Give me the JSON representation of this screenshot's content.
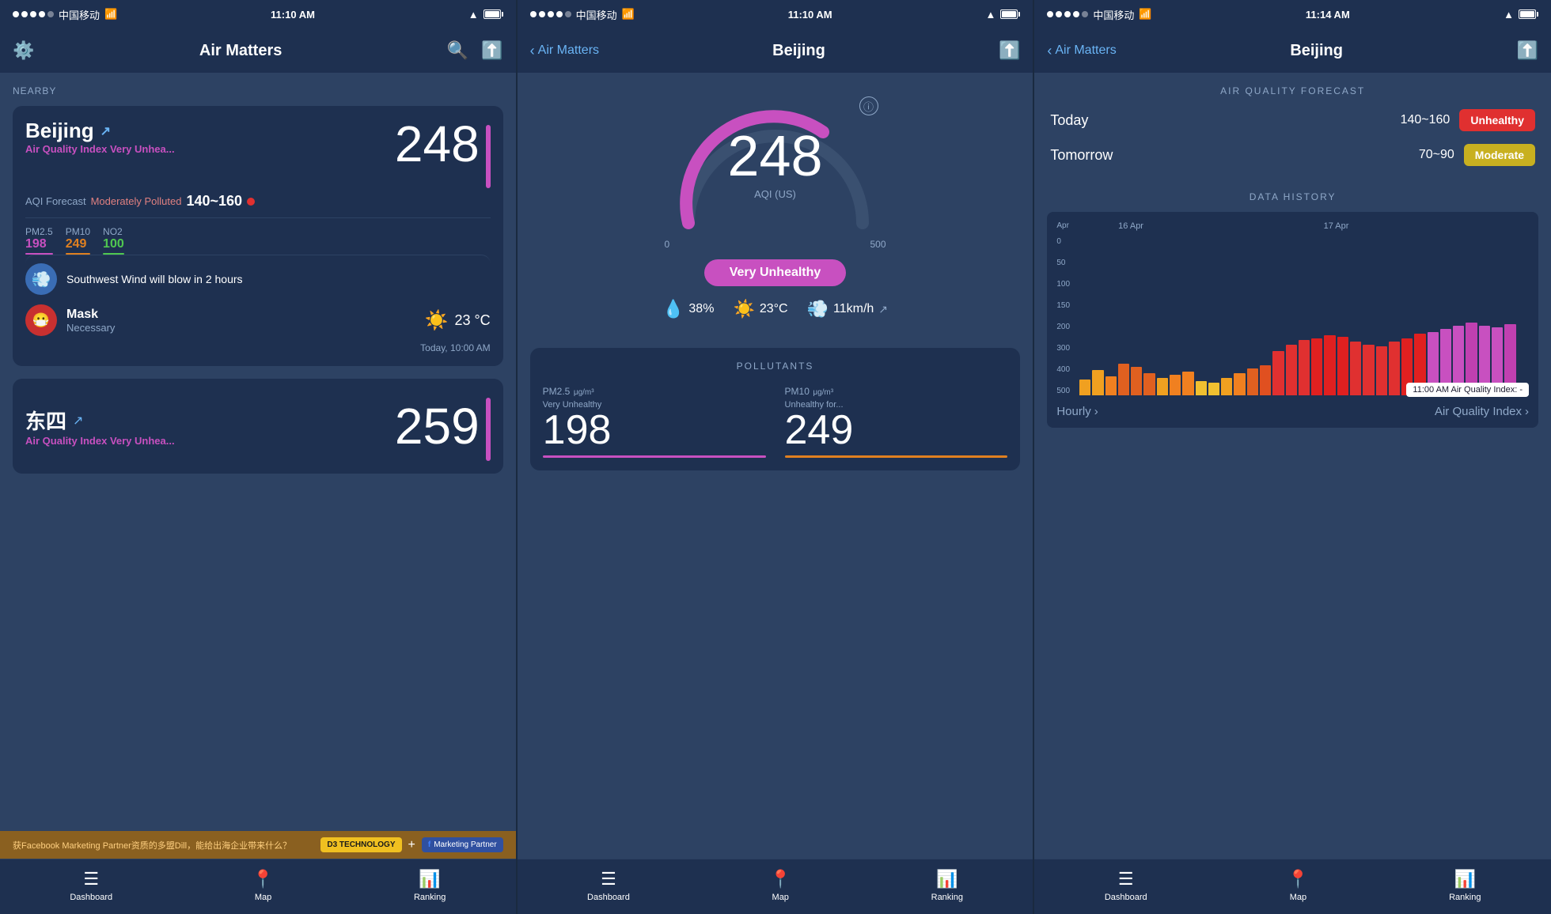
{
  "screen1": {
    "status": {
      "carrier": "中国移动",
      "time": "11:10 AM",
      "signal": true
    },
    "nav": {
      "title": "Air Matters"
    },
    "nearby_label": "NEARBY",
    "city1": {
      "name": "Beijing",
      "aqi": "248",
      "aqi_label": "Air Quality Index",
      "aqi_status": "Very Unhea...",
      "forecast_label": "AQI Forecast",
      "forecast_status": "Moderately Polluted",
      "forecast_range": "140~160",
      "pm25_label": "PM2.5",
      "pm25_value": "198",
      "pm10_label": "PM10",
      "pm10_value": "249",
      "no2_label": "NO2",
      "no2_value": "100",
      "wind_text": "Southwest Wind will blow in 2 hours",
      "mask_label": "Mask",
      "mask_sub": "Necessary",
      "temp": "23 °C",
      "timestamp": "Today, 10:00 AM"
    },
    "city2": {
      "name": "东四",
      "aqi": "259",
      "aqi_label": "Air Quality Index",
      "aqi_status": "Very Unhea..."
    },
    "ad": {
      "text": "获Facebook Marketing Partner资质的多盟Dill，能给出海企业带来什么？",
      "btn": "D3 TECHNOLOGY",
      "partner": "Marketing Partner"
    },
    "tabs": {
      "tab1": "Dashboard",
      "tab2": "Map",
      "tab3": "Ranking"
    }
  },
  "screen2": {
    "status": {
      "carrier": "中国移动",
      "time": "11:10 AM"
    },
    "nav": {
      "back": "Air Matters",
      "title": "Beijing"
    },
    "gauge": {
      "value": "248",
      "unit": "AQI (US)",
      "min": "0",
      "max": "500",
      "status": "Very Unhealthy"
    },
    "weather": {
      "humidity": "38%",
      "temp": "23°C",
      "wind": "11km/h"
    },
    "pollutants_title": "POLLUTANTS",
    "pollutants": {
      "pm25_label": "PM2.5",
      "pm25_unit": "μg/m³",
      "pm25_status": "Very Unhealthy",
      "pm25_value": "198",
      "pm10_label": "PM10",
      "pm10_unit": "μg/m³",
      "pm10_status": "Unhealthy for...",
      "pm10_value": "249"
    },
    "tabs": {
      "tab1": "Dashboard",
      "tab2": "Map",
      "tab3": "Ranking"
    }
  },
  "screen3": {
    "status": {
      "carrier": "中国移动",
      "time": "11:14 AM"
    },
    "nav": {
      "back": "Air Matters",
      "title": "Beijing"
    },
    "forecast": {
      "title": "AIR QUALITY FORECAST",
      "today_label": "Today",
      "today_range": "140~160",
      "today_status": "Unhealthy",
      "tomorrow_label": "Tomorrow",
      "tomorrow_range": "70~90",
      "tomorrow_status": "Moderate"
    },
    "history": {
      "title": "DATA HISTORY",
      "date1": "Apr",
      "date2": "16 Apr",
      "date3": "17 Apr",
      "y_labels": [
        "0",
        "50",
        "100",
        "150",
        "200",
        "300",
        "400",
        "500"
      ],
      "tooltip": "11:00 AM Air Quality Index: -",
      "hourly_btn": "Hourly",
      "aqi_btn": "Air Quality Index"
    },
    "tabs": {
      "tab1": "Dashboard",
      "tab2": "Map",
      "tab3": "Ranking"
    }
  }
}
